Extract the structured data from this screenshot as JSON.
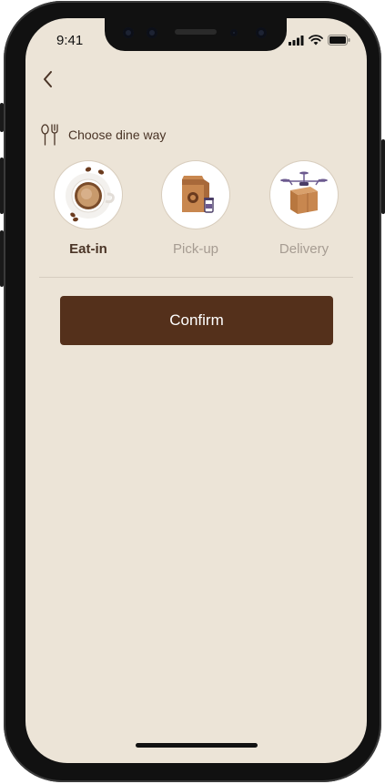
{
  "status_bar": {
    "time": "9:41",
    "icons": [
      "signal-icon",
      "wifi-icon",
      "battery-icon"
    ]
  },
  "nav": {
    "back_icon": "chevron-left-icon"
  },
  "dine_way": {
    "icon": "fork-spoon-icon",
    "label": "Choose dine way",
    "options": [
      {
        "label": "Eat-in",
        "icon": "coffee-cup-icon",
        "selected": true
      },
      {
        "label": "Pick-up",
        "icon": "takeaway-bag-icon",
        "selected": false
      },
      {
        "label": "Delivery",
        "icon": "drone-box-icon",
        "selected": false
      }
    ]
  },
  "confirm_label": "Confirm",
  "colors": {
    "background": "#ece4d7",
    "brand_brown": "#54301b",
    "text_dark": "#4a3426",
    "text_muted": "#a69c92"
  }
}
